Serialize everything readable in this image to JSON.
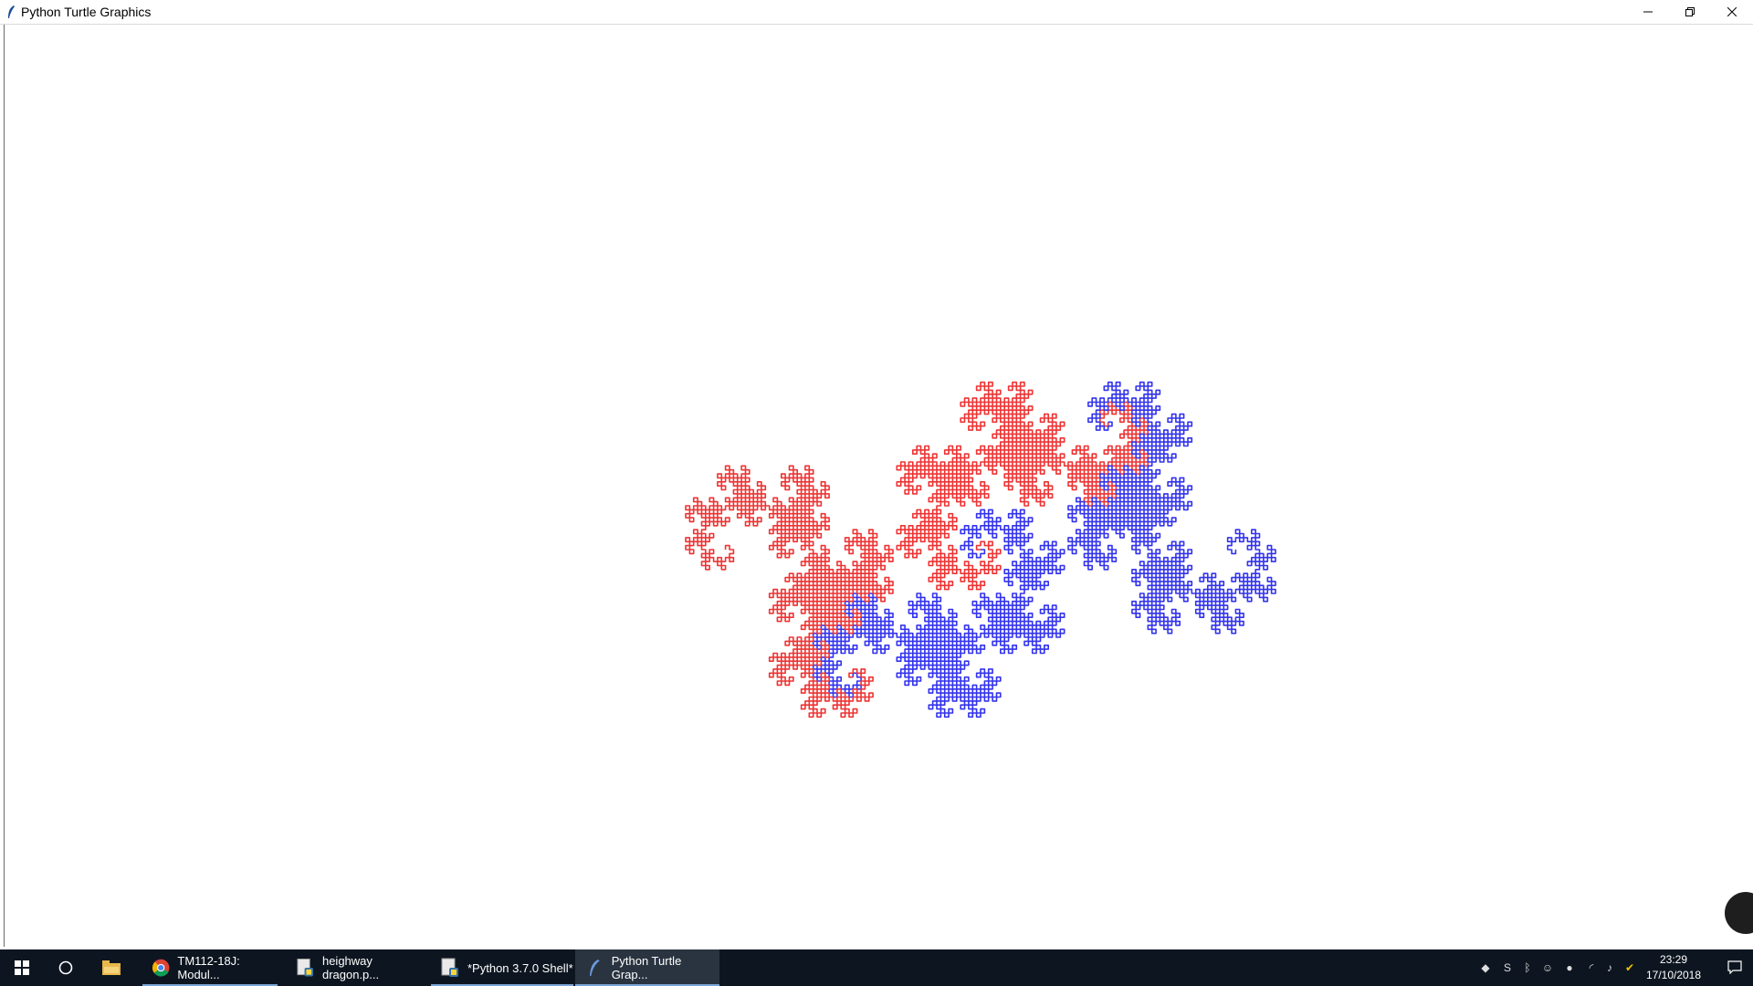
{
  "window": {
    "title": "Python Turtle Graphics",
    "icon": "feather-icon",
    "controls": {
      "minimize": "minimize-icon",
      "maximize": "restore-icon",
      "close": "close-icon"
    }
  },
  "canvas": {
    "background": "#ffffff",
    "drawing": "heighway-dragon-fractal",
    "colors": {
      "series_a": "#3333ee",
      "series_b": "#ee3333"
    }
  },
  "taskbar": {
    "start_icon": "windows-icon",
    "search_icon": "cortana-circle-icon",
    "files_icon": "file-explorer-icon",
    "apps": [
      {
        "label": "TM112-18J: Modul...",
        "icon": "chrome-icon",
        "active": false
      },
      {
        "label": "heighway dragon.p...",
        "icon": "python-file-icon",
        "active": false
      },
      {
        "label": "*Python 3.7.0 Shell*",
        "icon": "python-shell-icon",
        "active": false
      },
      {
        "label": "Python Turtle Grap...",
        "icon": "feather-icon",
        "active": true
      }
    ],
    "tray_icons": [
      "dropbox-icon",
      "network-s-icon",
      "bluetooth-icon",
      "people-icon",
      "globe-icon",
      "wifi-icon",
      "volume-icon",
      "norton-icon"
    ],
    "clock": {
      "time": "23:29",
      "date": "17/10/2018"
    },
    "notification_icon": "action-center-icon"
  }
}
